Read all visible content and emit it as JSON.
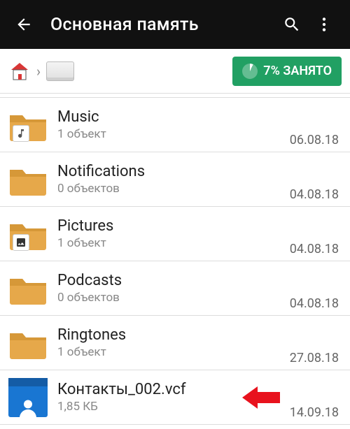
{
  "appbar": {
    "title": "Основная память"
  },
  "usage": {
    "label": "7% ЗАНЯТО"
  },
  "items": [
    {
      "name": "Music",
      "sub": "1 объект",
      "date": "06.08.18",
      "icon": "music"
    },
    {
      "name": "Notifications",
      "sub": "0 объектов",
      "date": "04.08.18",
      "icon": "folder"
    },
    {
      "name": "Pictures",
      "sub": "1 объект",
      "date": "04.08.18",
      "icon": "picture"
    },
    {
      "name": "Podcasts",
      "sub": "0 объектов",
      "date": "04.08.18",
      "icon": "folder"
    },
    {
      "name": "Ringtones",
      "sub": "1 объект",
      "date": "27.08.18",
      "icon": "folder"
    },
    {
      "name": "Контакты_002.vcf",
      "sub": "1,85 КБ",
      "date": "14.09.18",
      "icon": "contacts",
      "highlight": true
    }
  ]
}
